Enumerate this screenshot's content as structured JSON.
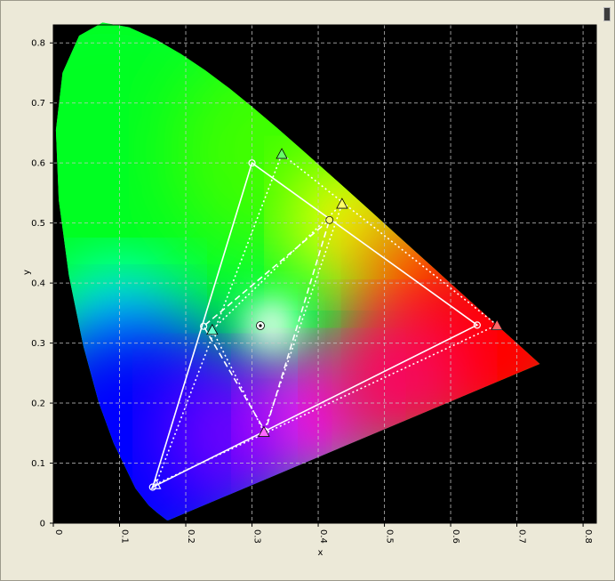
{
  "chart_data": {
    "type": "scatter",
    "subtype": "cie-1931-chromaticity-diagram",
    "xlabel": "x",
    "ylabel": "y",
    "xlim": [
      0,
      0.82
    ],
    "ylim": [
      0,
      0.83
    ],
    "x_ticks": [
      "0",
      "0.1",
      "0.2",
      "0.3",
      "0.4",
      "0.5",
      "0.6",
      "0.7",
      "0.8"
    ],
    "y_ticks": [
      "0",
      "0.1",
      "0.2",
      "0.3",
      "0.4",
      "0.5",
      "0.6",
      "0.7",
      "0.8"
    ],
    "grid": true,
    "background": "#000000",
    "spectral_locus": [
      [
        0.1741,
        0.005
      ],
      [
        0.173,
        0.0048
      ],
      [
        0.1714,
        0.0051
      ],
      [
        0.1689,
        0.0069
      ],
      [
        0.1644,
        0.0109
      ],
      [
        0.1566,
        0.0177
      ],
      [
        0.144,
        0.0297
      ],
      [
        0.1241,
        0.0578
      ],
      [
        0.0913,
        0.1327
      ],
      [
        0.0687,
        0.2007
      ],
      [
        0.0454,
        0.295
      ],
      [
        0.0235,
        0.4127
      ],
      [
        0.0082,
        0.5384
      ],
      [
        0.0039,
        0.6548
      ],
      [
        0.0139,
        0.7502
      ],
      [
        0.0389,
        0.812
      ],
      [
        0.0743,
        0.8338
      ],
      [
        0.1142,
        0.8262
      ],
      [
        0.1547,
        0.8059
      ],
      [
        0.1929,
        0.7816
      ],
      [
        0.2296,
        0.7543
      ],
      [
        0.2658,
        0.7243
      ],
      [
        0.3016,
        0.6923
      ],
      [
        0.3373,
        0.6589
      ],
      [
        0.3731,
        0.6245
      ],
      [
        0.4087,
        0.5896
      ],
      [
        0.4441,
        0.5547
      ],
      [
        0.4788,
        0.5202
      ],
      [
        0.5125,
        0.4866
      ],
      [
        0.5448,
        0.4544
      ],
      [
        0.5752,
        0.4242
      ],
      [
        0.6029,
        0.3965
      ],
      [
        0.627,
        0.3725
      ],
      [
        0.6482,
        0.3514
      ],
      [
        0.6658,
        0.334
      ],
      [
        0.6915,
        0.3083
      ],
      [
        0.7079,
        0.292
      ],
      [
        0.7347,
        0.2653
      ]
    ],
    "series": [
      {
        "style": "solid",
        "color": "#ffffff",
        "marker": "circle",
        "points": [
          [
            0.64,
            0.33
          ],
          [
            0.3,
            0.6
          ],
          [
            0.15,
            0.06
          ]
        ]
      },
      {
        "style": "dotted",
        "color": "#ffffff",
        "marker": "triangle",
        "points": [
          [
            0.67,
            0.33
          ],
          [
            0.345,
            0.615
          ],
          [
            0.155,
            0.065
          ]
        ]
      },
      {
        "style": "dashed",
        "color": "#ffffff",
        "marker": "circle",
        "points": [
          [
            0.417,
            0.505
          ],
          [
            0.227,
            0.328
          ],
          [
            0.32,
            0.153
          ]
        ]
      },
      {
        "style": "dotted",
        "color": "#ffffff",
        "marker": "triangle",
        "points": [
          [
            0.436,
            0.532
          ],
          [
            0.24,
            0.322
          ],
          [
            0.318,
            0.152
          ]
        ]
      }
    ],
    "markers": [
      {
        "name": "white-point",
        "shape": "circle-dot",
        "x": 0.3127,
        "y": 0.329,
        "fill": "#ffffff"
      },
      {
        "name": "yellow-circle",
        "shape": "circle",
        "x": 0.417,
        "y": 0.505,
        "fill": "#ffff66"
      },
      {
        "name": "yellow-triangle",
        "shape": "triangle",
        "x": 0.436,
        "y": 0.532,
        "fill": "#ffff66"
      },
      {
        "name": "cyan-triangle",
        "shape": "triangle",
        "x": 0.24,
        "y": 0.322,
        "fill": "#66ffcc"
      },
      {
        "name": "magenta-triangle",
        "shape": "triangle",
        "x": 0.318,
        "y": 0.152,
        "fill": "#ff66ff"
      },
      {
        "name": "red-triangle",
        "shape": "triangle",
        "x": 0.67,
        "y": 0.33,
        "fill": "#ff6666"
      },
      {
        "name": "green-triangle",
        "shape": "triangle",
        "x": 0.345,
        "y": 0.615,
        "fill": "#66ff66"
      }
    ],
    "colors": {
      "red": "#ff0000",
      "green": "#00ff00",
      "blue": "#0000ff",
      "grid": "#c8c8c8",
      "lines": "#ffffff"
    }
  }
}
